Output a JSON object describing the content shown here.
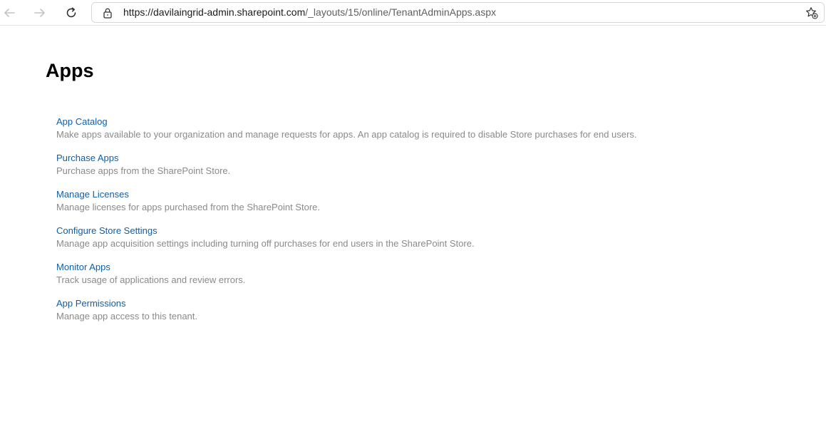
{
  "browser": {
    "url_prefix": "https://davilaingrid-admin.sharepoint.com",
    "url_rest": "/_layouts/15/online/TenantAdminApps.aspx"
  },
  "page": {
    "title": "Apps"
  },
  "apps": [
    {
      "label": "App Catalog",
      "description": "Make apps available to your organization and manage requests for apps. An app catalog is required to disable Store purchases for end users.",
      "highlighted": true
    },
    {
      "label": "Purchase Apps",
      "description": "Purchase apps from the SharePoint Store."
    },
    {
      "label": "Manage Licenses",
      "description": "Manage licenses for apps purchased from the SharePoint Store."
    },
    {
      "label": "Configure Store Settings",
      "description": "Manage app acquisition settings including turning off purchases for end users in the SharePoint Store."
    },
    {
      "label": "Monitor Apps",
      "description": "Track usage of applications and review errors."
    },
    {
      "label": "App Permissions",
      "description": "Manage app access to this tenant."
    }
  ],
  "colors": {
    "link": "#0f5fa8",
    "description": "#8a8a8a",
    "highlight": "#ffff33"
  },
  "icons": {
    "back": "back-arrow-icon",
    "forward": "forward-arrow-icon",
    "refresh": "refresh-icon",
    "lock": "lock-icon",
    "favorites": "add-favorite-icon"
  }
}
